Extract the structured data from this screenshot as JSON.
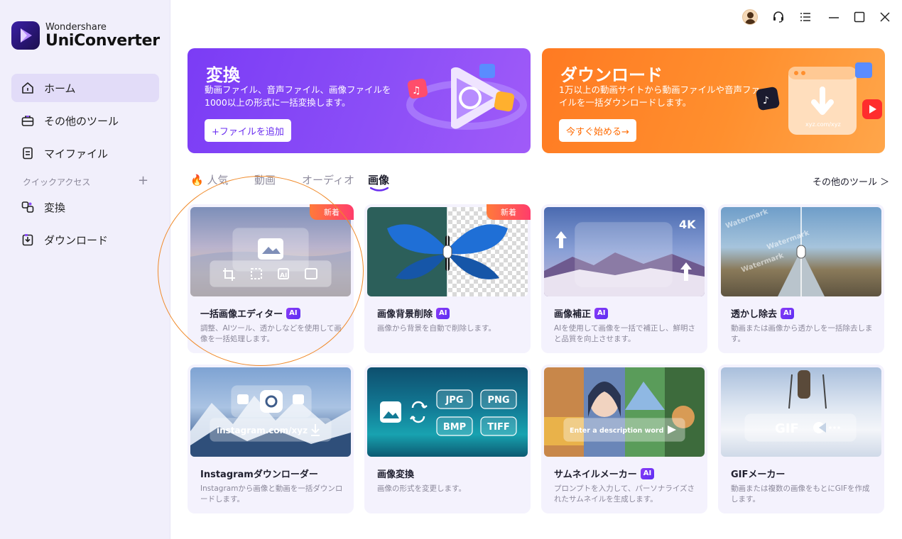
{
  "brand": {
    "top": "Wondershare",
    "name": "UniConverter"
  },
  "sidebar": {
    "items": [
      {
        "label": "ホーム"
      },
      {
        "label": "その他のツール"
      },
      {
        "label": "マイファイル"
      }
    ],
    "quick_access_label": "クイックアクセス",
    "quick_items": [
      {
        "label": "変換"
      },
      {
        "label": "ダウンロード"
      }
    ]
  },
  "banners": {
    "convert": {
      "title": "変換",
      "desc": "動画ファイル、音声ファイル、画像ファイルを1000以上の形式に一括変換します。",
      "button": "+ファイルを追加"
    },
    "download": {
      "title": "ダウンロード",
      "desc": "1万以上の動画サイトから動画ファイルや音声ファイルを一括ダウンロードします。",
      "button": "今すぐ始める→",
      "art_url_text": "xyz.com/xyz"
    }
  },
  "tabs": [
    {
      "label": "人気"
    },
    {
      "label": "動画"
    },
    {
      "label": "オーディオ"
    },
    {
      "label": "画像"
    }
  ],
  "more_tools": "その他のツール ＞",
  "cards": [
    {
      "title": "一括画像エディター",
      "ai": "AI",
      "badge": "新着",
      "desc": "調整、AIツール、透かしなどを使用して画像を一括処理します。"
    },
    {
      "title": "画像背景削除",
      "ai": "AI",
      "badge": "新着",
      "desc": "画像から背景を自動で削除します。"
    },
    {
      "title": "画像補正",
      "ai": "AI",
      "desc": "AIを使用して画像を一括で補正し、鮮明さと品質を向上させます。",
      "img_label": "4K"
    },
    {
      "title": "透かし除去",
      "ai": "AI",
      "desc": "動画または画像から透かしを一括除去します。",
      "img_label": "Watermark"
    },
    {
      "title": "Instagramダウンローダー",
      "desc": "Instagramから画像と動画を一括ダウンロードします。",
      "img_label": "instagram.com/xyz"
    },
    {
      "title": "画像変換",
      "desc": "画像の形式を変更します。",
      "formats": [
        "JPG",
        "PNG",
        "BMP",
        "TIFF"
      ]
    },
    {
      "title": "サムネイルメーカー",
      "ai": "AI",
      "desc": "プロンプトを入力して、パーソナライズされたサムネイルを生成します。",
      "img_label": "Enter a description word"
    },
    {
      "title": "GIFメーカー",
      "desc": "動画または複数の画像をもとにGIFを作成します。",
      "img_label": "GIF"
    }
  ],
  "colors": {
    "accent": "#6b2ff0",
    "download_accent": "#ff7a22",
    "ring": "#f08a2a"
  }
}
